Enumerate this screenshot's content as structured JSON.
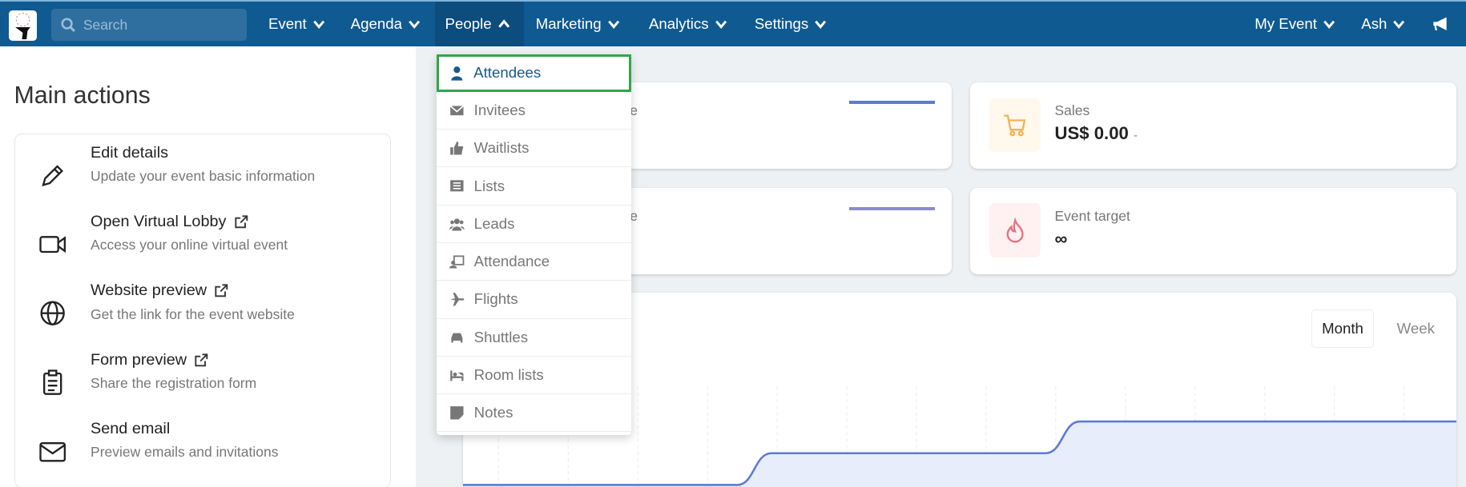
{
  "nav": {
    "search_placeholder": "Search",
    "items": [
      {
        "label": "Event"
      },
      {
        "label": "Agenda"
      },
      {
        "label": "People",
        "active": true
      },
      {
        "label": "Marketing"
      },
      {
        "label": "Analytics"
      },
      {
        "label": "Settings"
      }
    ],
    "right": [
      {
        "label": "My Event"
      },
      {
        "label": "Ash"
      }
    ],
    "announce_icon": "megaphone-icon",
    "color": "#0f5a91"
  },
  "main_actions": {
    "title": "Main actions",
    "items": [
      {
        "icon": "pencil-icon",
        "title": "Edit details",
        "subtitle": "Update your event basic information",
        "external": false
      },
      {
        "icon": "video-camera-icon",
        "title": "Open Virtual Lobby",
        "subtitle": "Access your online virtual event",
        "external": true
      },
      {
        "icon": "globe-icon",
        "title": "Website preview",
        "subtitle": "Get the link for the event website",
        "external": true
      },
      {
        "icon": "clipboard-icon",
        "title": "Form preview",
        "subtitle": "Share the registration form",
        "external": true
      },
      {
        "icon": "envelope-icon",
        "title": "Send email",
        "subtitle": "Preview emails and invitations",
        "external": false
      }
    ]
  },
  "people_menu": {
    "items": [
      {
        "label": "Attendees",
        "icon": "user-icon",
        "selected": true
      },
      {
        "label": "Invitees",
        "icon": "envelope-icon"
      },
      {
        "label": "Waitlists",
        "icon": "thumbs-up-icon"
      },
      {
        "label": "Lists",
        "icon": "list-icon"
      },
      {
        "label": "Leads",
        "icon": "users-icon"
      },
      {
        "label": "Attendance",
        "icon": "attendance-icon"
      },
      {
        "label": "Flights",
        "icon": "plane-icon"
      },
      {
        "label": "Shuttles",
        "icon": "car-icon"
      },
      {
        "label": "Room lists",
        "icon": "bed-icon"
      },
      {
        "label": "Notes",
        "icon": "note-icon"
      }
    ],
    "highlight_color": "#2ea84a"
  },
  "stats": {
    "card1_partial": "ple",
    "card3_partial": "ple",
    "sales": {
      "label": "Sales",
      "value": "US$ 0.00",
      "delta": "-"
    },
    "target": {
      "label": "Event target",
      "value": "∞"
    }
  },
  "chart_toggle": {
    "month": "Month",
    "week": "Week",
    "selected": "Month"
  },
  "chart_data": {
    "type": "area",
    "line_color": "#5b7bd6",
    "fill_color": "#e8edfb",
    "values": [
      0,
      0,
      0,
      0,
      0,
      0,
      0,
      0,
      0,
      1,
      1,
      1,
      1,
      1,
      1,
      1,
      1,
      1,
      2,
      2,
      2,
      2,
      2,
      2,
      2,
      2,
      2,
      2,
      2,
      2
    ],
    "grid": "vertical dashed"
  }
}
